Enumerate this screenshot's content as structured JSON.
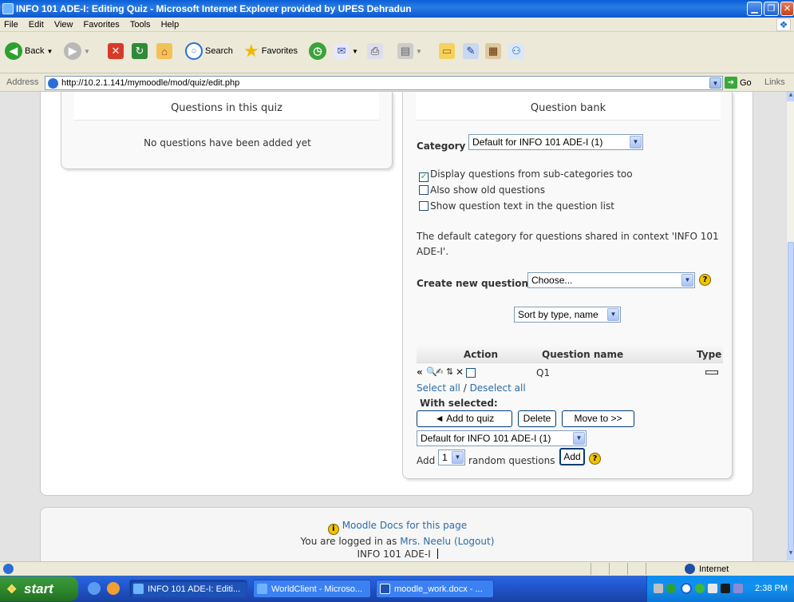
{
  "window": {
    "title": "INFO 101 ADE-I: Editing Quiz - Microsoft Internet Explorer provided by UPES Dehradun"
  },
  "menu": [
    "File",
    "Edit",
    "View",
    "Favorites",
    "Tools",
    "Help"
  ],
  "toolbar": {
    "back": "Back",
    "search": "Search",
    "favorites": "Favorites"
  },
  "address": {
    "label": "Address",
    "url": "http://10.2.1.141/mymoodle/mod/quiz/edit.php",
    "go": "Go",
    "links": "Links"
  },
  "left_block": {
    "title": "Questions in this quiz",
    "empty_message": "No questions have been added yet"
  },
  "bank": {
    "title": "Question bank",
    "category_label": "Category",
    "category_value": "Default for INFO 101 ADE-I (1)",
    "checkboxes": [
      {
        "label": "Display questions from sub-categories too",
        "checked": true
      },
      {
        "label": "Also show old questions",
        "checked": false
      },
      {
        "label": "Show question text in the question list",
        "checked": false
      }
    ],
    "info_text": "The default category for questions shared in context 'INFO 101 ADE-I'.",
    "create_label": "Create new question",
    "create_value": "Choose...",
    "sort_value": "Sort by type, name",
    "columns": {
      "action": "Action",
      "name": "Question name",
      "type": "Type"
    },
    "rows": [
      {
        "name": "Q1"
      }
    ],
    "select_all": "Select all",
    "separator": "/",
    "deselect_all": "Deselect all",
    "with_selected": "With selected:",
    "add_to_quiz": "◄ Add to quiz",
    "delete": "Delete",
    "move_to": "Move to >>",
    "move_target": "Default for INFO 101 ADE-I (1)",
    "add_prefix": "Add",
    "random_count": "1",
    "random_suffix": "random questions",
    "add_button": "Add"
  },
  "footer": {
    "docs_link": "Moodle Docs for this page",
    "logged_in_prefix": "You are logged in as",
    "user": "Mrs. Neelu",
    "logout": "(Logout)",
    "course": "INFO 101 ADE-I"
  },
  "status": {
    "zone": "Internet"
  },
  "taskbar": {
    "start": "start",
    "tasks": [
      "INFO 101 ADE-I: Editi...",
      "WorldClient - Microso...",
      "moodle_work.docx - ..."
    ],
    "time": "2:38 PM"
  },
  "colors": {
    "link": "#2a6ba8",
    "taskbar": "#245edb",
    "start": "#2d8a2d"
  }
}
